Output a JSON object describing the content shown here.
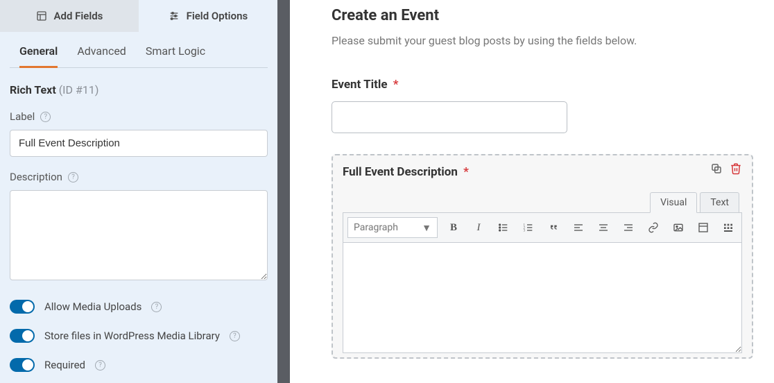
{
  "leftPanel": {
    "topTabs": {
      "addFields": "Add Fields",
      "fieldOptions": "Field Options"
    },
    "subTabs": {
      "general": "General",
      "advanced": "Advanced",
      "smartLogic": "Smart Logic"
    },
    "fieldHeading": {
      "name": "Rich Text",
      "id": "(ID #11)"
    },
    "labels": {
      "label": "Label",
      "description": "Description"
    },
    "values": {
      "label": "Full Event Description",
      "description": ""
    },
    "toggles": {
      "allowMedia": "Allow Media Uploads",
      "storeMedia": "Store files in WordPress Media Library",
      "required": "Required"
    }
  },
  "rightPanel": {
    "formTitle": "Create an Event",
    "formDesc": "Please submit your guest blog posts by using the fields below.",
    "eventTitle": {
      "label": "Event Title"
    },
    "richField": {
      "label": "Full Event Description",
      "tabs": {
        "visual": "Visual",
        "text": "Text"
      },
      "formatSelect": "Paragraph"
    }
  }
}
